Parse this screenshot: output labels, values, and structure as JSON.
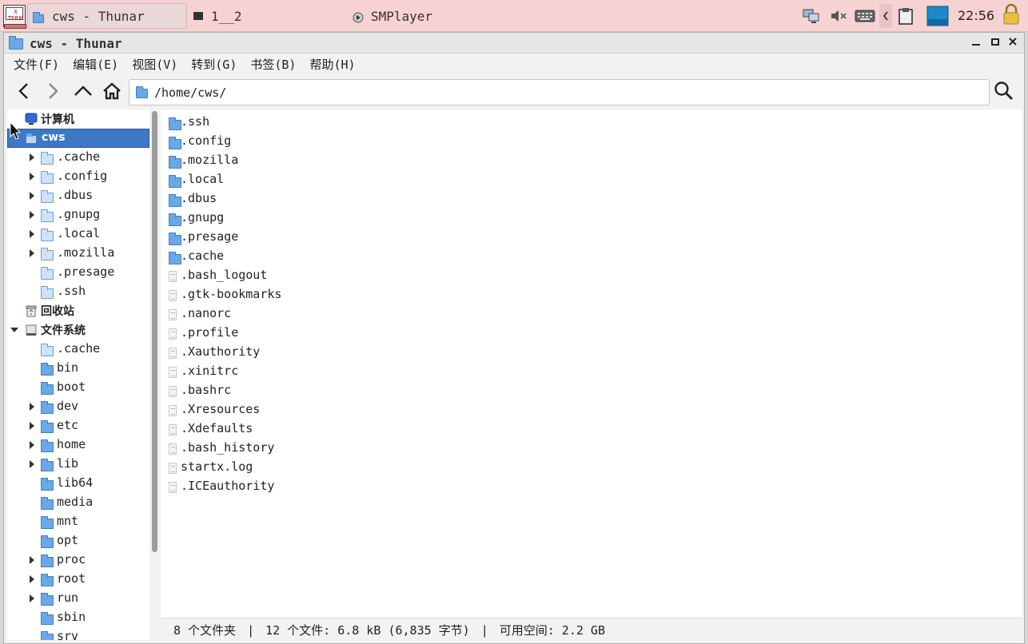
{
  "panel": {
    "tasks": [
      {
        "label": "cws - Thunar",
        "active": true
      },
      {
        "label": "1__2",
        "active": false
      },
      {
        "label": "SMPlayer",
        "active": false
      }
    ],
    "launcher_label": "X TERM",
    "clock": "22:56"
  },
  "window": {
    "title": "cws - Thunar",
    "menus": [
      "文件(F)",
      "编辑(E)",
      "视图(V)",
      "转到(G)",
      "书签(B)",
      "帮助(H)"
    ],
    "location_path": "/home/cws/"
  },
  "sidebar": {
    "items": [
      {
        "label": "计算机",
        "type": "computer",
        "indent": 0,
        "arrow": "none",
        "bold": true
      },
      {
        "label": "cws",
        "type": "home",
        "indent": 0,
        "arrow": "none",
        "bold": true,
        "selected": true
      },
      {
        "label": ".cache",
        "type": "folder-light",
        "indent": 1,
        "arrow": "right"
      },
      {
        "label": ".config",
        "type": "folder-light",
        "indent": 1,
        "arrow": "right"
      },
      {
        "label": ".dbus",
        "type": "folder-light",
        "indent": 1,
        "arrow": "right"
      },
      {
        "label": ".gnupg",
        "type": "folder-light",
        "indent": 1,
        "arrow": "right"
      },
      {
        "label": ".local",
        "type": "folder-light",
        "indent": 1,
        "arrow": "right"
      },
      {
        "label": ".mozilla",
        "type": "folder-light",
        "indent": 1,
        "arrow": "right"
      },
      {
        "label": ".presage",
        "type": "folder-light",
        "indent": 1,
        "arrow": "none"
      },
      {
        "label": ".ssh",
        "type": "folder-light",
        "indent": 1,
        "arrow": "none"
      },
      {
        "label": "回收站",
        "type": "trash",
        "indent": 0,
        "arrow": "none",
        "bold": true
      },
      {
        "label": "文件系统",
        "type": "drive",
        "indent": 0,
        "arrow": "down",
        "bold": true
      },
      {
        "label": ".cache",
        "type": "folder-light",
        "indent": 1,
        "arrow": "none"
      },
      {
        "label": "bin",
        "type": "folder",
        "indent": 1,
        "arrow": "none"
      },
      {
        "label": "boot",
        "type": "folder",
        "indent": 1,
        "arrow": "none"
      },
      {
        "label": "dev",
        "type": "folder",
        "indent": 1,
        "arrow": "right"
      },
      {
        "label": "etc",
        "type": "folder",
        "indent": 1,
        "arrow": "right"
      },
      {
        "label": "home",
        "type": "folder",
        "indent": 1,
        "arrow": "right"
      },
      {
        "label": "lib",
        "type": "folder",
        "indent": 1,
        "arrow": "right"
      },
      {
        "label": "lib64",
        "type": "folder",
        "indent": 1,
        "arrow": "none"
      },
      {
        "label": "media",
        "type": "folder",
        "indent": 1,
        "arrow": "none"
      },
      {
        "label": "mnt",
        "type": "folder",
        "indent": 1,
        "arrow": "none"
      },
      {
        "label": "opt",
        "type": "folder",
        "indent": 1,
        "arrow": "none"
      },
      {
        "label": "proc",
        "type": "folder",
        "indent": 1,
        "arrow": "right"
      },
      {
        "label": "root",
        "type": "folder",
        "indent": 1,
        "arrow": "right"
      },
      {
        "label": "run",
        "type": "folder",
        "indent": 1,
        "arrow": "right"
      },
      {
        "label": "sbin",
        "type": "folder",
        "indent": 1,
        "arrow": "none"
      },
      {
        "label": "srv",
        "type": "folder",
        "indent": 1,
        "arrow": "none"
      }
    ]
  },
  "files": [
    {
      "name": ".ssh",
      "type": "folder"
    },
    {
      "name": ".config",
      "type": "folder"
    },
    {
      "name": ".mozilla",
      "type": "folder"
    },
    {
      "name": ".local",
      "type": "folder"
    },
    {
      "name": ".dbus",
      "type": "folder"
    },
    {
      "name": ".gnupg",
      "type": "folder"
    },
    {
      "name": ".presage",
      "type": "folder"
    },
    {
      "name": ".cache",
      "type": "folder"
    },
    {
      "name": ".bash_logout",
      "type": "file"
    },
    {
      "name": ".gtk-bookmarks",
      "type": "file"
    },
    {
      "name": ".nanorc",
      "type": "file"
    },
    {
      "name": ".profile",
      "type": "file"
    },
    {
      "name": ".Xauthority",
      "type": "file"
    },
    {
      "name": ".xinitrc",
      "type": "file"
    },
    {
      "name": ".bashrc",
      "type": "file"
    },
    {
      "name": ".Xresources",
      "type": "file"
    },
    {
      "name": ".Xdefaults",
      "type": "file"
    },
    {
      "name": ".bash_history",
      "type": "file"
    },
    {
      "name": "startx.log",
      "type": "file"
    },
    {
      "name": ".ICEauthority",
      "type": "file"
    }
  ],
  "status": {
    "folders": "8 个文件夹",
    "sep1": "|",
    "files": "12 个文件: 6.8 kB (6,835 字节)",
    "sep2": "|",
    "free": "可用空间: 2.2 GB"
  },
  "colors": {
    "panel_bg": "#f7d2d2",
    "selection": "#3c78c6",
    "folder": "#6aa9e6"
  }
}
